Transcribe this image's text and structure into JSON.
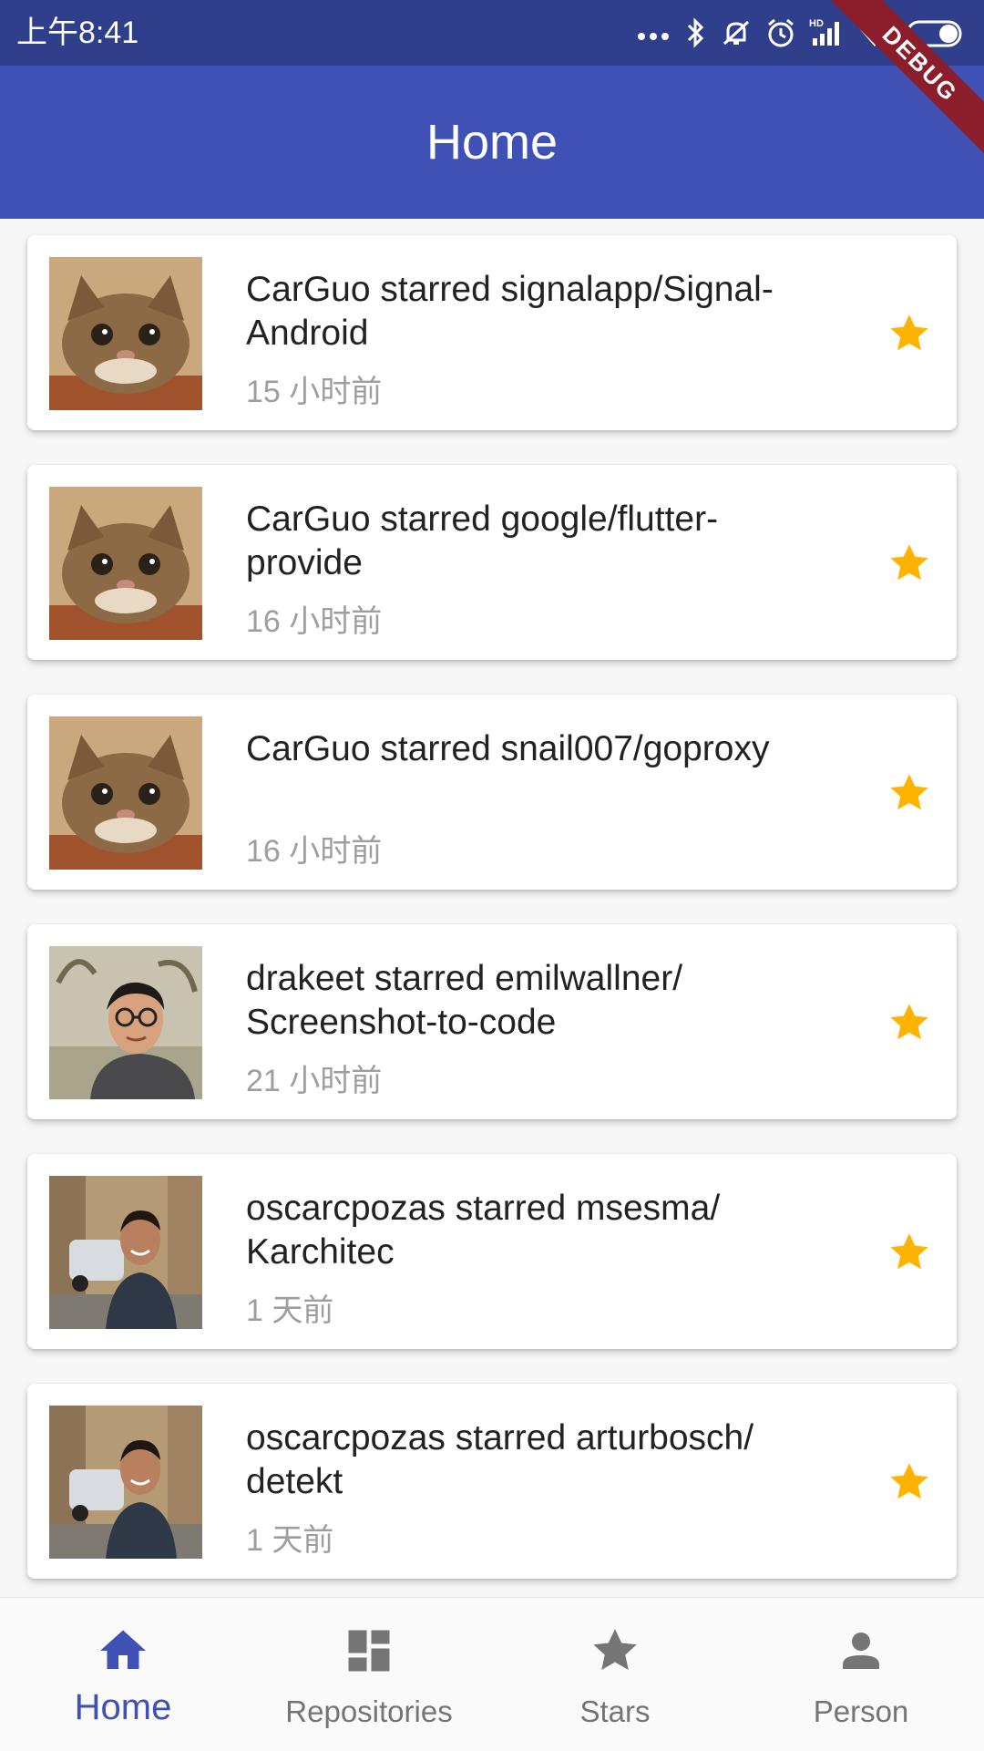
{
  "status_bar": {
    "time": "上午8:41"
  },
  "debug_banner": "DEBUG",
  "app_bar": {
    "title": "Home"
  },
  "feed": [
    {
      "user": "CarGuo",
      "title": "CarGuo starred signalapp/Signal-Android",
      "title_lines": [
        "CarGuo starred signalapp/Signal-",
        "Android"
      ],
      "time": "15 小时前",
      "avatar": "cat"
    },
    {
      "user": "CarGuo",
      "title": "CarGuo starred google/flutter-provide",
      "title_lines": [
        "CarGuo starred google/flutter-",
        "provide"
      ],
      "time": "16 小时前",
      "avatar": "cat"
    },
    {
      "user": "CarGuo",
      "title": "CarGuo starred snail007/goproxy",
      "title_lines": [
        "CarGuo starred snail007/goproxy"
      ],
      "time": "16 小时前",
      "avatar": "cat"
    },
    {
      "user": "drakeet",
      "title": "drakeet starred emilwallner/Screenshot-to-code",
      "title_lines": [
        "drakeet starred emilwallner/",
        "Screenshot-to-code"
      ],
      "time": "21 小时前",
      "avatar": "person-glasses"
    },
    {
      "user": "oscarcpozas",
      "title": "oscarcpozas starred msesma/Karchitec",
      "title_lines": [
        "oscarcpozas starred msesma/",
        "Karchitec"
      ],
      "time": "1 天前",
      "avatar": "person-street"
    },
    {
      "user": "oscarcpozas",
      "title": "oscarcpozas starred arturbosch/detekt",
      "title_lines": [
        "oscarcpozas starred arturbosch/",
        "detekt"
      ],
      "time": "1 天前",
      "avatar": "person-street"
    }
  ],
  "bottom_nav": [
    {
      "label": "Home",
      "icon": "home-icon",
      "active": true
    },
    {
      "label": "Repositories",
      "icon": "dashboard-icon",
      "active": false
    },
    {
      "label": "Stars",
      "icon": "star-icon",
      "active": false
    },
    {
      "label": "Person",
      "icon": "person-icon",
      "active": false
    }
  ],
  "colors": {
    "primary": "#3F51B5",
    "status_bar": "#303F8C",
    "star": "#FFB300",
    "secondary_text": "#9E9E9E"
  }
}
